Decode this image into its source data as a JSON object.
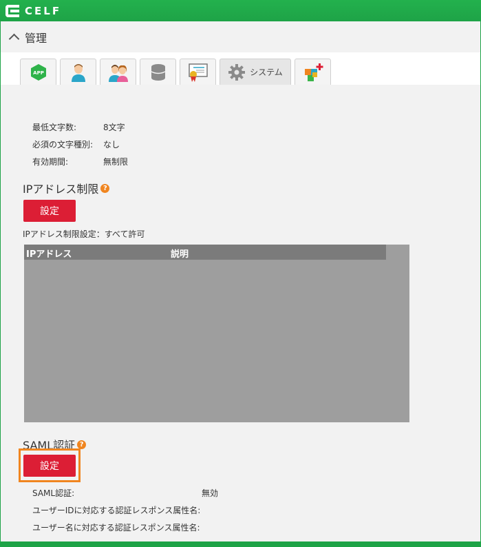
{
  "app": {
    "logo_text": "CELF"
  },
  "admin": {
    "title": "管理"
  },
  "tabs": [
    {
      "icon": "app-icon",
      "label": ""
    },
    {
      "icon": "user-icon",
      "label": ""
    },
    {
      "icon": "users-icon",
      "label": ""
    },
    {
      "icon": "database-icon",
      "label": ""
    },
    {
      "icon": "certificate-icon",
      "label": ""
    },
    {
      "icon": "gear-icon",
      "label": "システム"
    },
    {
      "icon": "plugin-icon",
      "label": ""
    }
  ],
  "app_icon_text": "APP",
  "password_policy": {
    "min_length_label": "最低文字数:",
    "min_length_value": "8文字",
    "required_types_label": "必須の文字種別:",
    "required_types_value": "なし",
    "validity_label": "有効期間:",
    "validity_value": "無制限"
  },
  "ip_restriction": {
    "title": "IPアドレス制限",
    "help": "?",
    "button_label": "設定",
    "status_text": "IPアドレス制限設定：すべて許可",
    "columns": [
      "IPアドレス",
      "説明"
    ]
  },
  "saml": {
    "title": "SAML認証",
    "help": "?",
    "button_label": "設定",
    "auth_label": "SAML認証:",
    "auth_value": "無効",
    "userid_attr_label": "ユーザーIDに対応する認証レスポンス属性名:",
    "username_attr_label": "ユーザー名に対応する認証レスポンス属性名:"
  },
  "colors": {
    "brand_green": "#1ea347",
    "button_red": "#dc1e35",
    "highlight_orange": "#f0851f"
  }
}
